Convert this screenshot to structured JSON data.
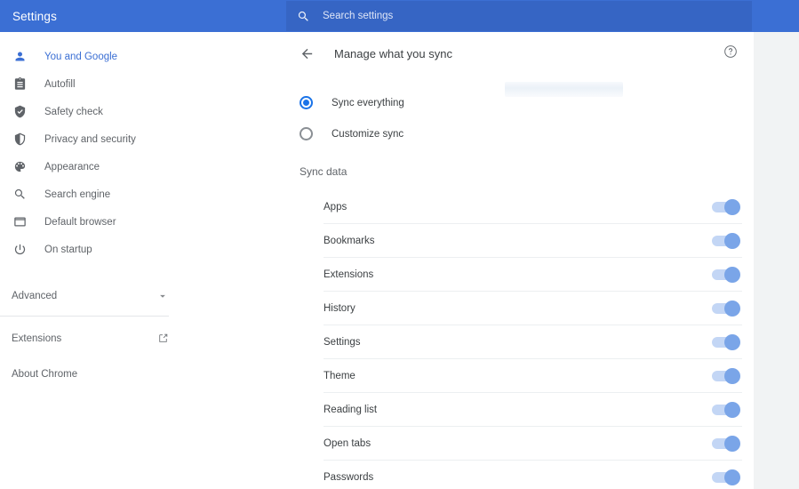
{
  "topbar": {
    "title": "Settings",
    "search_placeholder": "Search settings",
    "search_value": "",
    "search_icon": "search-icon",
    "background_color": "#3b6fd4",
    "search_background_color": "#3665c4"
  },
  "sidebar": {
    "items": [
      {
        "label": "You and Google",
        "icon": "person-icon",
        "active": true
      },
      {
        "label": "Autofill",
        "icon": "clipboard-icon",
        "active": false
      },
      {
        "label": "Safety check",
        "icon": "shield-check-icon",
        "active": false
      },
      {
        "label": "Privacy and security",
        "icon": "shield-half-icon",
        "active": false
      },
      {
        "label": "Appearance",
        "icon": "palette-icon",
        "active": false
      },
      {
        "label": "Search engine",
        "icon": "magnifier-icon",
        "active": false
      },
      {
        "label": "Default browser",
        "icon": "browser-window-icon",
        "active": false
      },
      {
        "label": "On startup",
        "icon": "power-icon",
        "active": false
      }
    ],
    "advanced": {
      "label": "Advanced",
      "icon": "chevron-down-icon"
    },
    "footer_items": [
      {
        "label": "Extensions",
        "icon": "external-link-icon"
      },
      {
        "label": "About Chrome",
        "icon": null
      }
    ],
    "active_color": "#3b6fd4",
    "text_color": "#5f6368"
  },
  "main": {
    "back_icon": "back-arrow-icon",
    "title": "Manage what you sync",
    "help_icon": "help-circle-icon",
    "sync_mode": {
      "options": [
        {
          "label": "Sync everything",
          "selected": true
        },
        {
          "label": "Customize sync",
          "selected": false
        }
      ],
      "selected_color": "#1a73e8"
    },
    "section_title": "Sync data",
    "sync_items": [
      {
        "label": "Apps",
        "enabled": true
      },
      {
        "label": "Bookmarks",
        "enabled": true
      },
      {
        "label": "Extensions",
        "enabled": true
      },
      {
        "label": "History",
        "enabled": true
      },
      {
        "label": "Settings",
        "enabled": true
      },
      {
        "label": "Theme",
        "enabled": true
      },
      {
        "label": "Reading list",
        "enabled": true
      },
      {
        "label": "Open tabs",
        "enabled": true
      },
      {
        "label": "Passwords",
        "enabled": true
      }
    ],
    "toggle_track_color": "#c3d6f5",
    "toggle_knob_color": "#7aa5e8"
  }
}
